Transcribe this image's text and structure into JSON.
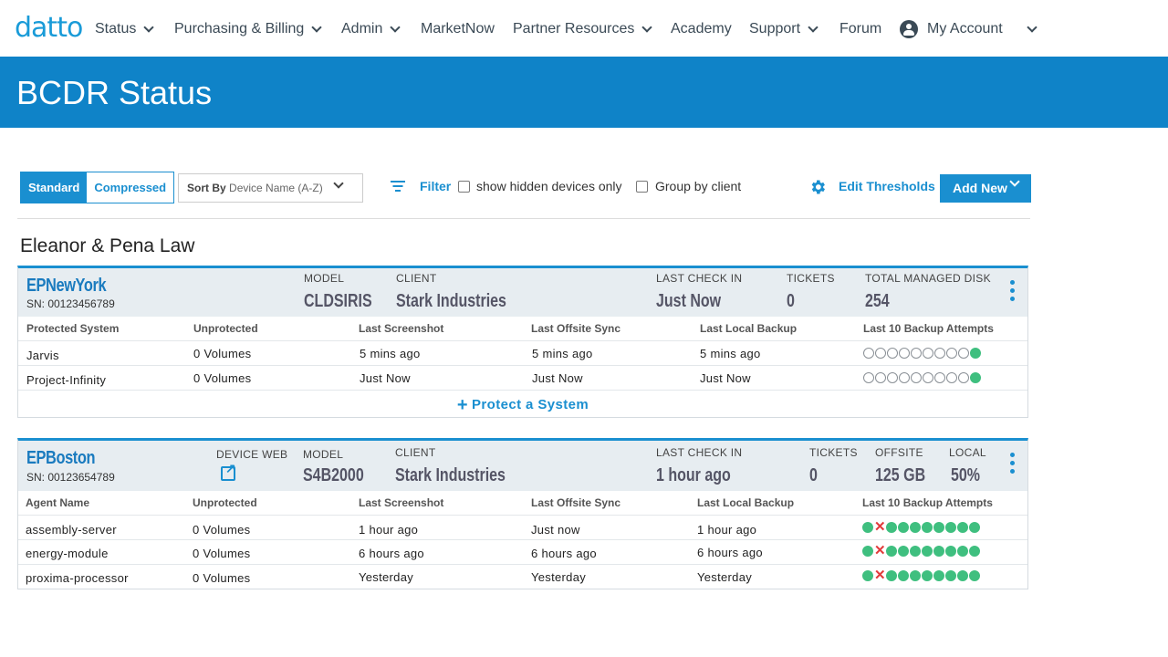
{
  "nav": {
    "logo": "datto",
    "items": [
      {
        "label": "Status",
        "dropdown": true
      },
      {
        "label": "Purchasing & Billing",
        "dropdown": true
      },
      {
        "label": "Admin",
        "dropdown": true
      },
      {
        "label": "MarketNow",
        "dropdown": false
      },
      {
        "label": "Partner Resources",
        "dropdown": true
      },
      {
        "label": "Academy",
        "dropdown": false
      },
      {
        "label": "Support",
        "dropdown": true
      },
      {
        "label": "Forum",
        "dropdown": false
      }
    ],
    "account": "My Account"
  },
  "page_title": "BCDR Status",
  "toolbar": {
    "view_standard": "Standard",
    "view_compressed": "Compressed",
    "sort_label": "Sort By",
    "sort_value": "Device Name (A-Z)",
    "filter": "Filter",
    "hidden_only": "show hidden devices only",
    "group_by_client": "Group by client",
    "edit_thresholds": "Edit Thresholds",
    "add_new": "Add New"
  },
  "client_group": "Eleanor & Pena Law",
  "devices": [
    {
      "name": "EPNewYork",
      "sn": "SN: 00123456789",
      "labels": {
        "model": "MODEL",
        "client": "CLIENT",
        "last_check_in": "LAST CHECK IN",
        "tickets": "TICKETS",
        "disk": "TOTAL MANAGED DISK"
      },
      "model": "CLDSIRIS",
      "client": "Stark Industries",
      "last_check_in": "Just Now",
      "tickets": "0",
      "disk": "254",
      "columns": [
        "Protected System",
        "Unprotected",
        "Last Screenshot",
        "Last Offsite Sync",
        "Last Local Backup",
        "Last 10 Backup Attempts"
      ],
      "rows": [
        {
          "name": "Jarvis",
          "unprotected": "0 Volumes",
          "screenshot": "5 mins ago",
          "offsite": "5 mins ago",
          "local": "5 mins ago",
          "attempts": [
            "none",
            "none",
            "none",
            "none",
            "none",
            "none",
            "none",
            "none",
            "none",
            "ok"
          ]
        },
        {
          "name": "Project-Infinity",
          "unprotected": "0 Volumes",
          "screenshot": "Just Now",
          "offsite": "Just Now",
          "local": "Just Now",
          "attempts": [
            "none",
            "none",
            "none",
            "none",
            "none",
            "none",
            "none",
            "none",
            "none",
            "ok"
          ]
        }
      ],
      "protect_label": "Protect a System"
    },
    {
      "name": "EPBoston",
      "sn": "SN: 00123654789",
      "labels": {
        "device_web": "DEVICE WEB",
        "model": "MODEL",
        "client": "CLIENT",
        "last_check_in": "LAST CHECK IN",
        "tickets": "TICKETS",
        "offsite": "OFFSITE",
        "local": "LOCAL"
      },
      "model": "S4B2000",
      "client": "Stark Industries",
      "last_check_in": "1 hour ago",
      "tickets": "0",
      "offsite": "125 GB",
      "local": "50%",
      "columns": [
        "Agent Name",
        "Unprotected",
        "Last Screenshot",
        "Last Offsite Sync",
        "Last Local Backup",
        "Last 10 Backup Attempts"
      ],
      "rows": [
        {
          "name": "assembly-server",
          "unprotected": "0 Volumes",
          "screenshot": "1 hour ago",
          "offsite": "Just now",
          "local": "1 hour ago",
          "attempts": [
            "ok",
            "fail",
            "ok",
            "ok",
            "ok",
            "ok",
            "ok",
            "ok",
            "ok",
            "ok"
          ]
        },
        {
          "name": "energy-module",
          "unprotected": "0 Volumes",
          "screenshot": "6 hours ago",
          "offsite": "6 hours ago",
          "local": "6 hours ago",
          "attempts": [
            "ok",
            "fail",
            "ok",
            "ok",
            "ok",
            "ok",
            "ok",
            "ok",
            "ok",
            "ok"
          ]
        },
        {
          "name": "proxima-processor",
          "unprotected": "0 Volumes",
          "screenshot": "Yesterday",
          "offsite": "Yesterday",
          "local": "Yesterday",
          "attempts": [
            "ok",
            "fail",
            "ok",
            "ok",
            "ok",
            "ok",
            "ok",
            "ok",
            "ok",
            "ok"
          ]
        }
      ]
    }
  ],
  "colors": {
    "brand": "#199bd8",
    "banner": "#0f83c8",
    "accent": "#1a8fd0",
    "success": "#3fbf7f",
    "failure": "#e23b3b"
  }
}
